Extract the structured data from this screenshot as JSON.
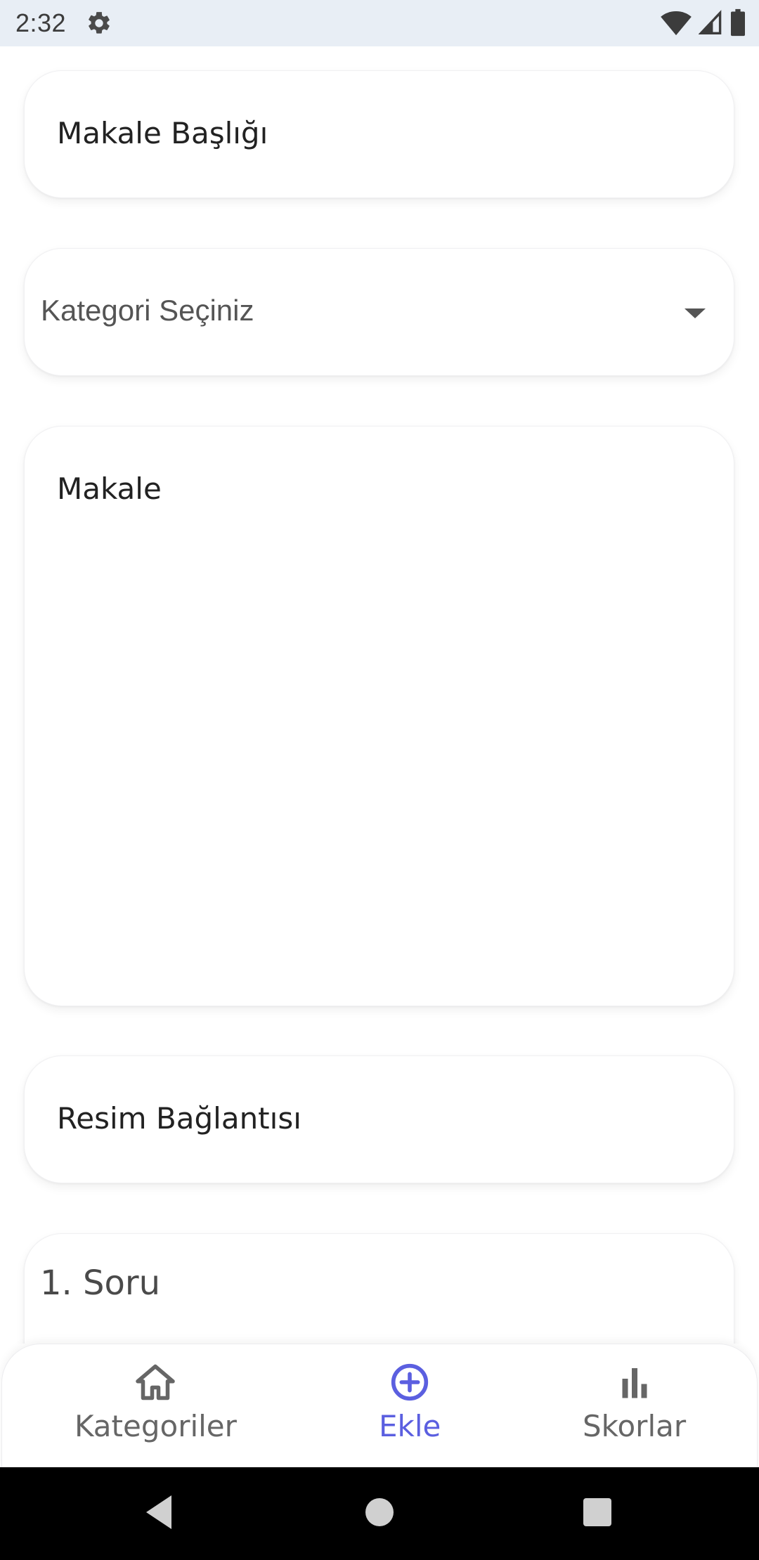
{
  "status_bar": {
    "time": "2:32",
    "icons": [
      "gear-icon",
      "wifi-icon",
      "signal-icon",
      "battery-icon"
    ]
  },
  "form": {
    "title_placeholder": "Makale Başlığı",
    "category_placeholder": "Kategori Seçiniz",
    "article_placeholder": "Makale",
    "image_link_placeholder": "Resim Bağlantısı",
    "question_label": "1. Soru"
  },
  "bottom_nav": {
    "items": [
      {
        "label": "Kategoriler",
        "icon": "home-icon",
        "active": false
      },
      {
        "label": "Ekle",
        "icon": "add-circle-icon",
        "active": true
      },
      {
        "label": "Skorlar",
        "icon": "bar-chart-icon",
        "active": false
      }
    ]
  },
  "colors": {
    "accent": "#5b5fe0",
    "status_bar_bg": "#e8eef5",
    "inactive": "#666666",
    "system_nav_bg": "#000000"
  },
  "system_nav": {
    "buttons": [
      "back-icon",
      "home-circle-icon",
      "recents-icon"
    ]
  }
}
